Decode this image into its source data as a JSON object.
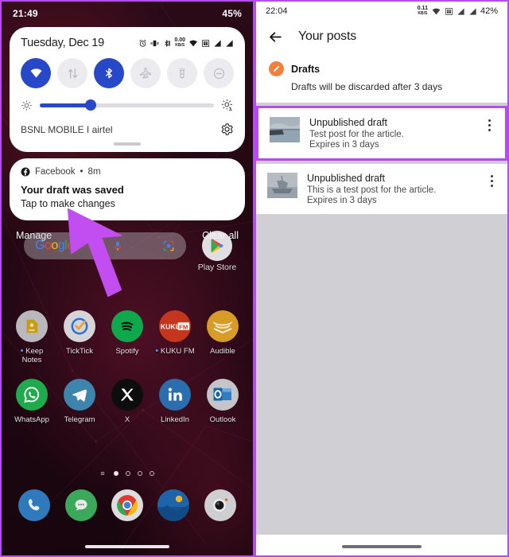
{
  "left_phone": {
    "status_bar": {
      "time": "21:49",
      "battery": "45%",
      "icons": [
        "alarm-icon",
        "vibrate-icon",
        "bluetooth-icon",
        "data-rate-icon",
        "wifi-icon",
        "sim-icon",
        "signal-1-icon",
        "signal-2-icon"
      ]
    },
    "quick_settings": {
      "date": "Tuesday, Dec 19",
      "status_icons": [
        "alarm-icon",
        "vibrate-icon",
        "bluetooth-icon",
        "data-rate-icon",
        "wifi-icon",
        "sim-icon",
        "signal-1-icon",
        "signal-2-icon"
      ],
      "data_rate": "0.00",
      "data_rate_unit": "KB/S",
      "tiles": [
        {
          "name": "wifi",
          "label": "Wi-Fi",
          "active": true
        },
        {
          "name": "mobile-data",
          "label": "Mobile data",
          "active": false
        },
        {
          "name": "bluetooth",
          "label": "Bluetooth",
          "active": true
        },
        {
          "name": "airplane-mode",
          "label": "Airplane mode",
          "active": false
        },
        {
          "name": "flashlight",
          "label": "Flashlight",
          "active": false
        },
        {
          "name": "do-not-disturb",
          "label": "Do Not Disturb",
          "active": false
        }
      ],
      "brightness_percent": 29,
      "carrier": "BSNL MOBILE I airtel",
      "settings_icon": "gear-icon",
      "accent_color": "#2749c9"
    },
    "notification": {
      "app": "Facebook",
      "separator": "•",
      "time": "8m",
      "title": "Your draft was saved",
      "subtitle": "Tap to make changes"
    },
    "notification_actions": {
      "manage": "Manage",
      "clear_all": "Clear all"
    },
    "search_bar": {
      "brand": "Google",
      "mic_icon": "microphone-icon",
      "lens_icon": "google-lens-icon"
    },
    "play_store": {
      "label": "Play Store",
      "icon": "play-store-icon"
    },
    "app_rows": [
      [
        {
          "name": "Keep Notes",
          "icon": "keep-notes-icon",
          "badge": true
        },
        {
          "name": "TickTick",
          "icon": "ticktick-icon",
          "badge": false
        },
        {
          "name": "Spotify",
          "icon": "spotify-icon",
          "badge": false
        },
        {
          "name": "KUKU FM",
          "icon": "kuku-fm-icon",
          "badge": true
        },
        {
          "name": "Audible",
          "icon": "audible-icon",
          "badge": false
        }
      ],
      [
        {
          "name": "WhatsApp",
          "icon": "whatsapp-icon",
          "badge": false
        },
        {
          "name": "Telegram",
          "icon": "telegram-icon",
          "badge": false
        },
        {
          "name": "X",
          "icon": "x-twitter-icon",
          "badge": false
        },
        {
          "name": "LinkedIn",
          "icon": "linkedin-icon",
          "badge": false
        },
        {
          "name": "Outlook",
          "icon": "outlook-icon",
          "badge": false
        }
      ]
    ],
    "page_indicator": {
      "pages": 4,
      "active": 0,
      "menu_glyph": "≡"
    },
    "dock": [
      {
        "name": "Phone",
        "icon": "phone-icon"
      },
      {
        "name": "Messages",
        "icon": "messages-icon"
      },
      {
        "name": "Chrome",
        "icon": "chrome-icon"
      },
      {
        "name": "Photos",
        "icon": "gallery-icon"
      },
      {
        "name": "Camera",
        "icon": "camera-icon"
      }
    ],
    "cursor": {
      "color": "#c24df0"
    }
  },
  "right_phone": {
    "status_bar": {
      "time": "22:04",
      "battery": "42%",
      "data_rate": "0.11",
      "data_rate_unit": "KB/S",
      "icons": [
        "data-rate-icon",
        "wifi-icon",
        "sim-icon",
        "signal-1-icon",
        "signal-2-icon"
      ]
    },
    "app_bar": {
      "back_icon": "back-arrow-icon",
      "title": "Your posts"
    },
    "drafts_section": {
      "icon": "pencil-icon",
      "title": "Drafts",
      "subtitle": "Drafts will be discarded after 3 days",
      "icon_color": "#f2803c"
    },
    "posts": [
      {
        "title": "Unpublished draft",
        "body": "Test post for the article.",
        "expires": "Expires in 3 days",
        "menu_icon": "kebab-menu-icon",
        "thumbnail": "lake-pier-photo",
        "highlighted": true
      },
      {
        "title": "Unpublished draft",
        "body": "This is a test post for the article.",
        "expires": "Expires in 3 days",
        "menu_icon": "kebab-menu-icon",
        "thumbnail": "boat-photo",
        "highlighted": false
      }
    ],
    "highlight_color": "#b44cf0"
  }
}
